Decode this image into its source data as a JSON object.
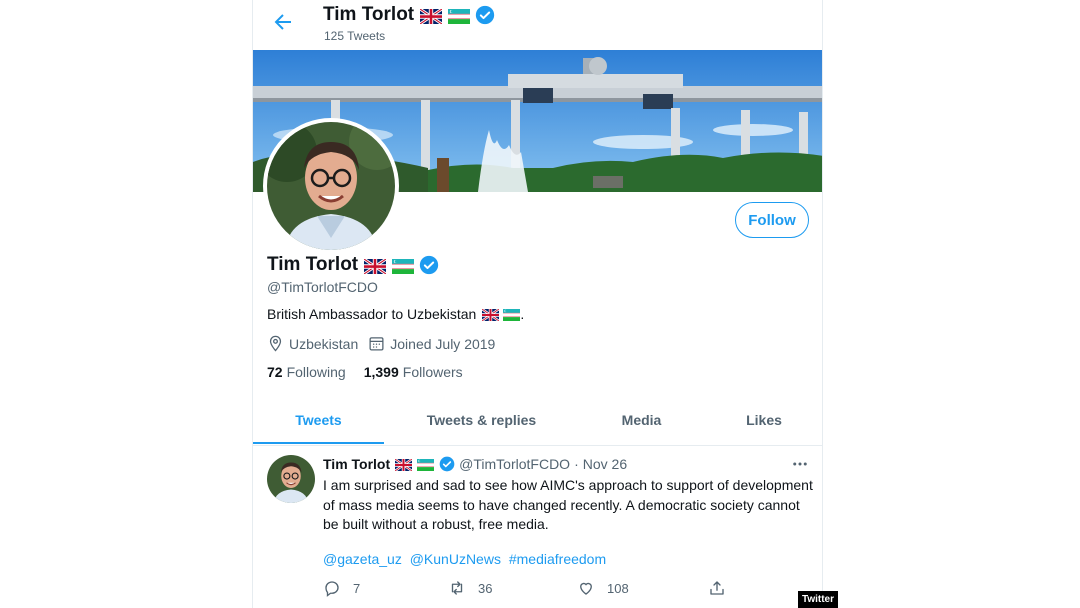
{
  "header": {
    "title": "Tim Torlot",
    "tweet_count": "125 Tweets"
  },
  "profile": {
    "name": "Tim Torlot",
    "handle": "@TimTorlotFCDO",
    "bio": "British Ambassador to Uzbekistan",
    "bio_suffix": ".",
    "location": "Uzbekistan",
    "joined": "Joined July 2019",
    "following_count": "72",
    "following_label": "Following",
    "followers_count": "1,399",
    "followers_label": "Followers",
    "follow_button": "Follow"
  },
  "tabs": [
    {
      "label": "Tweets",
      "active": true
    },
    {
      "label": "Tweets & replies",
      "active": false
    },
    {
      "label": "Media",
      "active": false
    },
    {
      "label": "Likes",
      "active": false
    }
  ],
  "tweet": {
    "name": "Tim Torlot",
    "handle": "@TimTorlotFCDO",
    "separator": "·",
    "date": "Nov 26",
    "text": "I am surprised and sad to see how AIMC's approach to support of development of mass media seems to have changed recently. A democratic society cannot be built without a robust, free media.",
    "links": [
      "@gazeta_uz",
      "@KunUzNews",
      "#mediafreedom"
    ],
    "replies": "7",
    "retweets": "36",
    "likes": "108"
  },
  "watermark": "Twitter",
  "colors": {
    "accent": "#1d9bf0",
    "secondary_text": "#536471",
    "primary_text": "#0f1419",
    "border": "#e6ecf0"
  },
  "icons": [
    "back-arrow-icon",
    "verified-badge-icon",
    "uk-flag-icon",
    "uzbekistan-flag-icon",
    "location-icon",
    "calendar-icon",
    "more-icon",
    "reply-icon",
    "retweet-icon",
    "like-icon",
    "share-icon"
  ]
}
